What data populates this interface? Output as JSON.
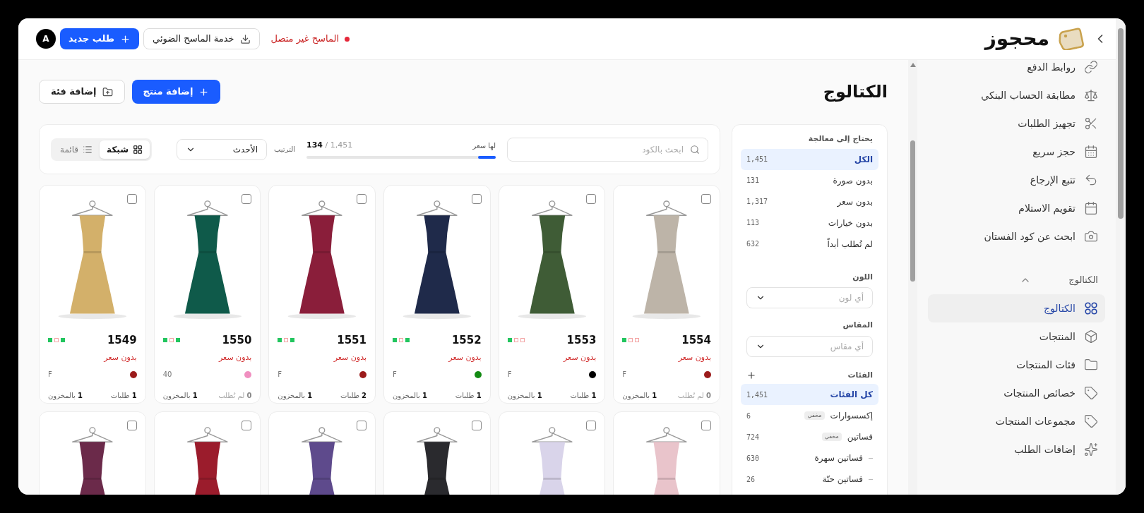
{
  "brand": {
    "name": "محجوز"
  },
  "header": {
    "status": {
      "text": "الماسح غير متصل",
      "connected": false
    },
    "buttons": [
      {
        "label": "خدمة الماسح الضوئي",
        "kind": "secondary"
      },
      {
        "label": "طلب جديد",
        "kind": "primary"
      }
    ],
    "avatar": "A"
  },
  "sidebar": {
    "items": [
      {
        "label": "روابط الدفع",
        "selected": false
      },
      {
        "label": "مطابقة الحساب البنكي",
        "selected": false
      },
      {
        "label": "تجهيز الطلبات",
        "selected": false
      },
      {
        "label": "حجز سريع",
        "selected": false
      },
      {
        "label": "تتبع الإرجاع",
        "selected": false
      },
      {
        "label": "تقويم الاستلام",
        "selected": false
      },
      {
        "label": "ابحث عن كود الفستان",
        "selected": false
      }
    ],
    "sections": [
      {
        "title": "الكتالوج",
        "expanded": true,
        "items": [
          {
            "label": "الكتالوج",
            "selected": true
          },
          {
            "label": "المنتجات",
            "selected": false
          },
          {
            "label": "فئات المنتجات",
            "selected": false
          },
          {
            "label": "خصائص المنتجات",
            "selected": false
          },
          {
            "label": "مجموعات المنتجات",
            "selected": false
          },
          {
            "label": "إضافات الطلب",
            "selected": false
          }
        ]
      }
    ]
  },
  "page": {
    "title": "الكتالوج",
    "buttons": [
      {
        "label": "إضافة منتج",
        "kind": "primary"
      },
      {
        "label": "إضافة فئة",
        "kind": "secondary"
      }
    ]
  },
  "filters": {
    "needs_processing": {
      "title": "يحتاج إلى معالجة",
      "items": [
        {
          "label": "الكل",
          "count": "1,451",
          "selected": true
        },
        {
          "label": "بدون صورة",
          "count": "131",
          "selected": false
        },
        {
          "label": "بدون سعر",
          "count": "1,317",
          "selected": false
        },
        {
          "label": "بدون خيارات",
          "count": "113",
          "selected": false
        },
        {
          "label": "لم تُطلب أبداً",
          "count": "632",
          "selected": false
        }
      ]
    },
    "color": {
      "label": "اللون",
      "placeholder": "أي لون"
    },
    "size": {
      "label": "المقاس",
      "placeholder": "أي مقاس"
    },
    "categories": {
      "title": "الفئات",
      "items": [
        {
          "label": "كل الفئات",
          "count": "1,451",
          "selected": true
        },
        {
          "label": "إكسسوارات",
          "badge": "مخفي",
          "count": "6",
          "selected": false
        },
        {
          "label": "فساتين",
          "badge": "مخفي",
          "count": "724",
          "selected": false,
          "children": [
            {
              "label": "فساتين سهرة",
              "count": "630",
              "selected": false
            },
            {
              "label": "فساتين حنّة",
              "count": "26",
              "selected": false
            }
          ]
        }
      ]
    }
  },
  "toolbar": {
    "search": {
      "placeholder": "ابحث بالكود"
    },
    "progress": {
      "label": "لها سعر",
      "count": "134",
      "total": "/ 1,451",
      "level": 0.092
    },
    "sort": {
      "label": "الترتيب",
      "value": "الأحدث"
    },
    "view": [
      {
        "label": "شبكة",
        "selected": true
      },
      {
        "label": "قائمة",
        "selected": false
      }
    ]
  },
  "products": [
    {
      "code": "1554",
      "checked": false,
      "dress": {
        "color": "#bdb4a8"
      },
      "checks": [
        true,
        false,
        false
      ],
      "price_status": "بدون سعر",
      "color": "#9b1b1b",
      "size": "F",
      "orders": {
        "count": "0",
        "label": "لم تُطلب",
        "never": true
      },
      "stock": {
        "count": "1",
        "label": "بالمخزون"
      }
    },
    {
      "code": "1553",
      "checked": false,
      "dress": {
        "color": "#3f5c36"
      },
      "checks": [
        true,
        false,
        false
      ],
      "price_status": "بدون سعر",
      "color": "#000000",
      "size": "F",
      "orders": {
        "count": "1",
        "label": "طلبات",
        "never": false
      },
      "stock": {
        "count": "1",
        "label": "بالمخزون"
      }
    },
    {
      "code": "1552",
      "checked": false,
      "dress": {
        "color": "#1f2a4a"
      },
      "checks": [
        true,
        false,
        true
      ],
      "price_status": "بدون سعر",
      "color": "#138a13",
      "size": "F",
      "orders": {
        "count": "1",
        "label": "طلبات",
        "never": false
      },
      "stock": {
        "count": "1",
        "label": "بالمخزون"
      }
    },
    {
      "code": "1551",
      "checked": false,
      "dress": {
        "color": "#8a1e3a"
      },
      "checks": [
        true,
        false,
        true
      ],
      "price_status": "بدون سعر",
      "color": "#9b1b1b",
      "size": "F",
      "orders": {
        "count": "2",
        "label": "طلبات",
        "never": false
      },
      "stock": {
        "count": "1",
        "label": "بالمخزون"
      }
    },
    {
      "code": "1550",
      "checked": false,
      "dress": {
        "color": "#0f5a4a"
      },
      "checks": [
        true,
        false,
        true
      ],
      "price_status": "بدون سعر",
      "color": "#f08fc0",
      "size": "40",
      "orders": {
        "count": "0",
        "label": "لم تُطلب",
        "never": true
      },
      "stock": {
        "count": "1",
        "label": "بالمخزون"
      }
    },
    {
      "code": "1549",
      "checked": false,
      "dress": {
        "color": "#d3b06a"
      },
      "checks": [
        true,
        false,
        true
      ],
      "price_status": "بدون سعر",
      "color": "#9b1b1b",
      "size": "F",
      "orders": {
        "count": "1",
        "label": "طلبات",
        "never": false
      },
      "stock": {
        "count": "1",
        "label": "بالمخزون"
      }
    },
    {
      "checked": false,
      "dress": {
        "color": "#e9c4cb"
      }
    },
    {
      "checked": false,
      "dress": {
        "color": "#d9d4ea"
      }
    },
    {
      "checked": false,
      "dress": {
        "color": "#2a2a2e"
      }
    },
    {
      "checked": false,
      "dress": {
        "color": "#5e4a8c"
      }
    },
    {
      "checked": false,
      "dress": {
        "color": "#9b1c2c"
      }
    },
    {
      "checked": false,
      "dress": {
        "color": "#6b2a4a"
      }
    }
  ]
}
